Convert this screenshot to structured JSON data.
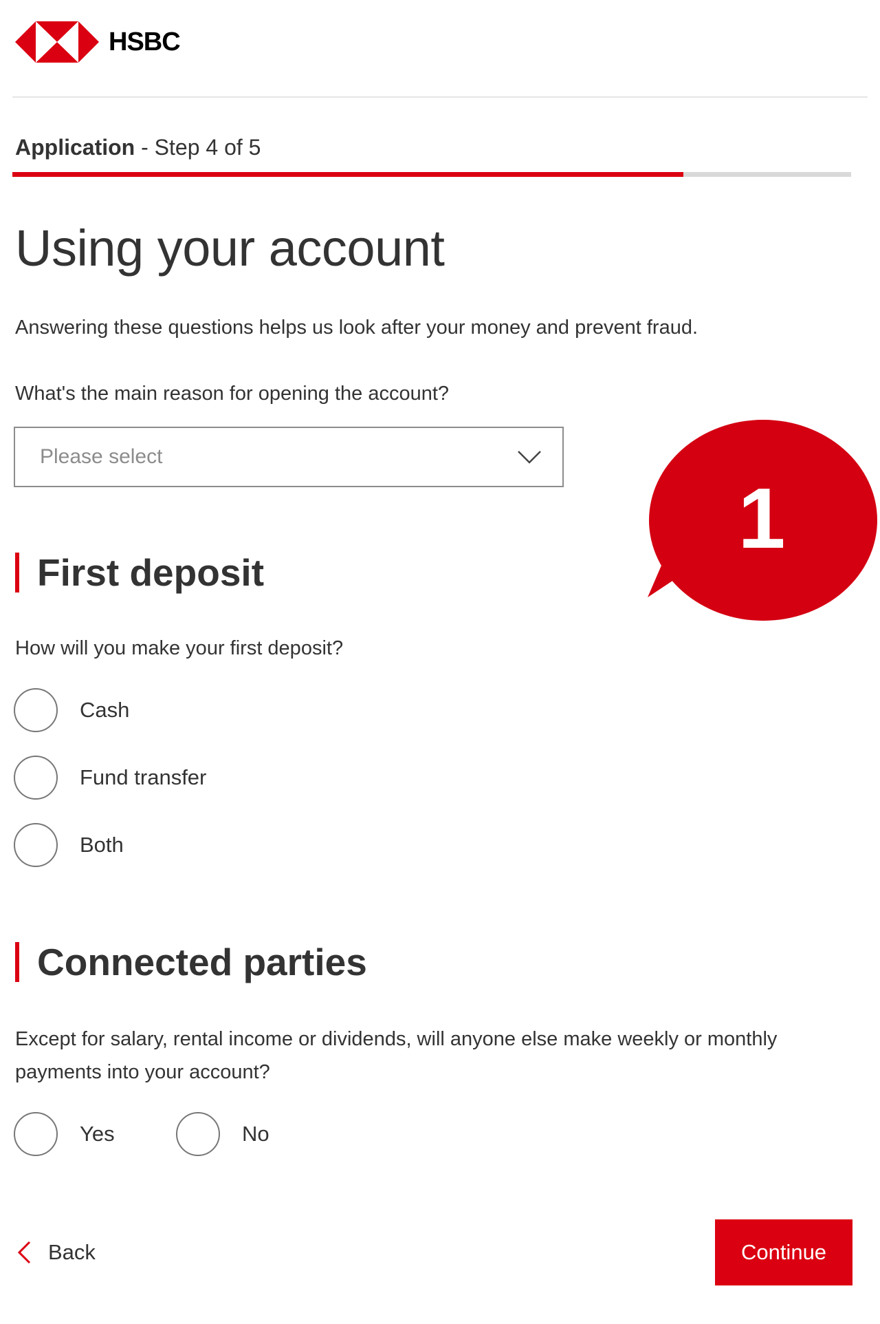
{
  "brand": {
    "name": "HSBC",
    "logo_icon": "hsbc-hexagon-logo",
    "accent_color": "#db0011"
  },
  "step": {
    "strong_label": "Application",
    "detail": " - Step 4 of 5",
    "current": 4,
    "total": 5,
    "progress_fraction": 0.8
  },
  "page": {
    "title": "Using your account",
    "intro": "Answering these questions helps us look after your money and prevent fraud."
  },
  "reason_question": {
    "label": "What's the main reason for opening the account?",
    "placeholder": "Please select",
    "icon": "chevron-down-icon"
  },
  "first_deposit": {
    "heading": "First deposit",
    "question": "How will you make your first deposit?",
    "options": [
      "Cash",
      "Fund transfer",
      "Both"
    ]
  },
  "connected_parties": {
    "heading": "Connected parties",
    "question": "Except for salary, rental income or dividends, will anyone else make weekly or monthly payments into your account?",
    "options": [
      "Yes",
      "No"
    ]
  },
  "footer": {
    "back_label": "Back",
    "back_icon": "chevron-left-icon",
    "continue_label": "Continue"
  },
  "annotation": {
    "number": "1",
    "color": "#d40012"
  }
}
